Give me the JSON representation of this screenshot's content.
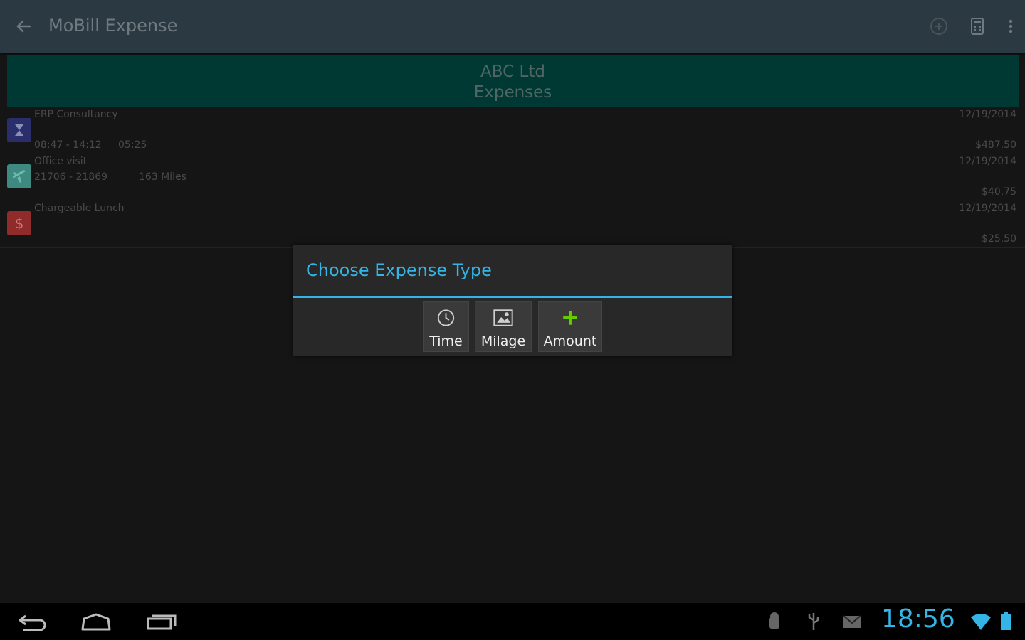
{
  "app": {
    "title": "MoBill Expense"
  },
  "header": {
    "company": "ABC Ltd",
    "subtitle": "Expenses"
  },
  "expenses": [
    {
      "title": "ERP Consultancy",
      "detail1": "08:47 - 14:12",
      "detail2": "05:25",
      "date": "12/19/2014",
      "amount": "$487.50",
      "icon": "hourglass-icon",
      "icon_color": "#2a2f6b"
    },
    {
      "title": "Office visit",
      "detail1": "21706 - 21869",
      "detail2": "163 Miles",
      "date": "12/19/2014",
      "amount": "$40.75",
      "icon": "airplane-icon",
      "icon_color": "#3e8a80"
    },
    {
      "title": "Chargeable Lunch",
      "detail1": "",
      "detail2": "",
      "date": "12/19/2014",
      "amount": "$25.50",
      "icon": "dollar-icon",
      "icon_color": "#8f2b2b"
    }
  ],
  "dialog": {
    "title": "Choose Expense Type",
    "buttons": [
      {
        "label": "Time",
        "icon": "clock-icon"
      },
      {
        "label": "Milage",
        "icon": "map-icon"
      },
      {
        "label": "Amount",
        "icon": "plus-icon"
      }
    ]
  },
  "status": {
    "time": "18:56"
  },
  "colors": {
    "accent": "#33b5e5",
    "actionbar": "#2b3942",
    "header_band": "#003933",
    "plus_green": "#66cc00"
  }
}
